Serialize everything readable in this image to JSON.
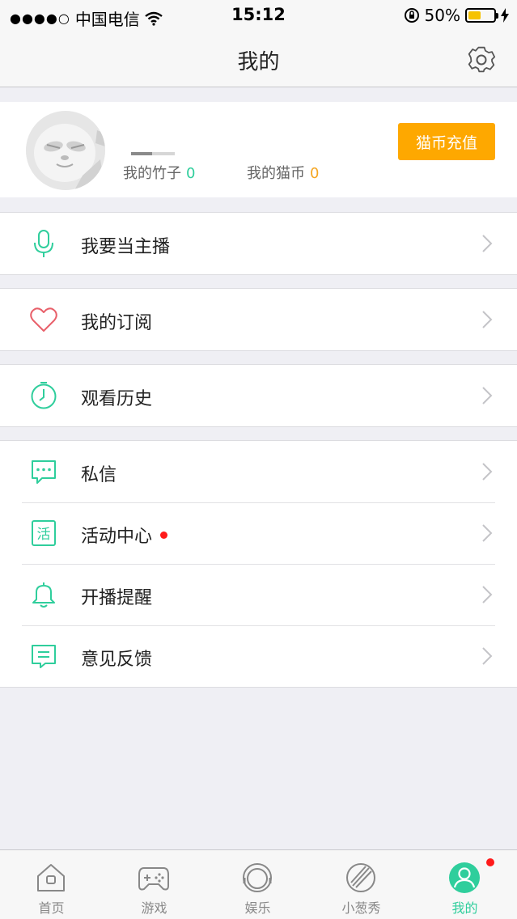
{
  "status_bar": {
    "signal": "●●●●○",
    "carrier": "中国电信",
    "time": "15:12",
    "battery_percent": "50%",
    "battery_level": 0.5
  },
  "nav": {
    "title": "我的"
  },
  "profile": {
    "bamboo_label": "我的竹子",
    "bamboo_value": "0",
    "coin_label": "我的猫币",
    "coin_value": "0",
    "recharge_label": "猫币充值"
  },
  "menu": {
    "broadcaster": {
      "label": "我要当主播",
      "icon": "microphone-icon"
    },
    "subscription": {
      "label": "我的订阅",
      "icon": "heart-icon"
    },
    "history": {
      "label": "观看历史",
      "icon": "clock-icon"
    },
    "messages": {
      "label": "私信",
      "icon": "chat-bubble-icon"
    },
    "events": {
      "label": "活动中心",
      "icon": "event-icon",
      "icon_text": "活",
      "badge": true
    },
    "reminder": {
      "label": "开播提醒",
      "icon": "bell-icon"
    },
    "feedback": {
      "label": "意见反馈",
      "icon": "feedback-icon"
    }
  },
  "tabs": [
    {
      "label": "首页",
      "icon": "home-icon",
      "active": false
    },
    {
      "label": "游戏",
      "icon": "gamepad-icon",
      "active": false
    },
    {
      "label": "娱乐",
      "icon": "entertainment-icon",
      "active": false
    },
    {
      "label": "小葱秀",
      "icon": "onion-show-icon",
      "active": false
    },
    {
      "label": "我的",
      "icon": "profile-icon",
      "active": true,
      "badge": true
    }
  ],
  "colors": {
    "accent": "#2fce9c",
    "recharge": "#fea800",
    "coin": "#f5a623",
    "heart": "#e8606a",
    "badge": "#ff1a1a"
  }
}
